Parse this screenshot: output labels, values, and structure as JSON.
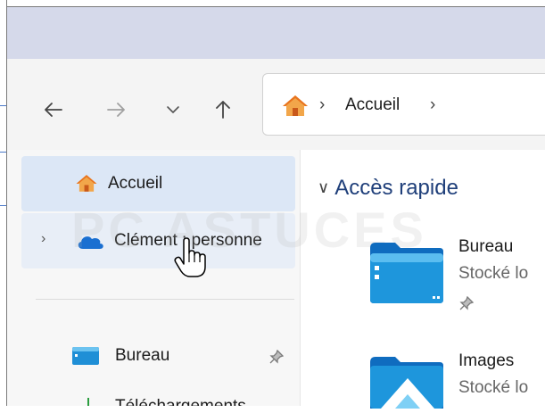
{
  "address_bar": {
    "crumb": "Accueil",
    "separator": "›"
  },
  "nav_buttons": {
    "back": "←",
    "forward": "→",
    "recent": "⌄",
    "up": "↑"
  },
  "nav_pane": {
    "items": [
      {
        "label": "Accueil",
        "icon": "home-icon",
        "selected": true
      },
      {
        "label": "Clément : personne",
        "icon": "onedrive-cloud-icon",
        "expandable": true
      },
      {
        "label": "Bureau",
        "icon": "desktop-folder-icon",
        "pinned": true
      },
      {
        "label": "Téléchargements",
        "icon": "download-icon",
        "pinned": true
      }
    ]
  },
  "main": {
    "section_title": "Accès rapide",
    "items": [
      {
        "name": "Bureau",
        "sub": "Stocké lo",
        "icon": "desktop-folder-icon",
        "pinned": true
      },
      {
        "name": "Images",
        "sub": "Stocké lo",
        "icon": "pictures-folder-icon"
      }
    ]
  },
  "watermark": "PC ASTUCES",
  "colors": {
    "titlebar": "#d5d9ea",
    "selected_item": "#dce7f6",
    "section_title": "#1f3f7a",
    "folder_blue": "#1f8fd6",
    "home_orange": "#e8731e"
  }
}
